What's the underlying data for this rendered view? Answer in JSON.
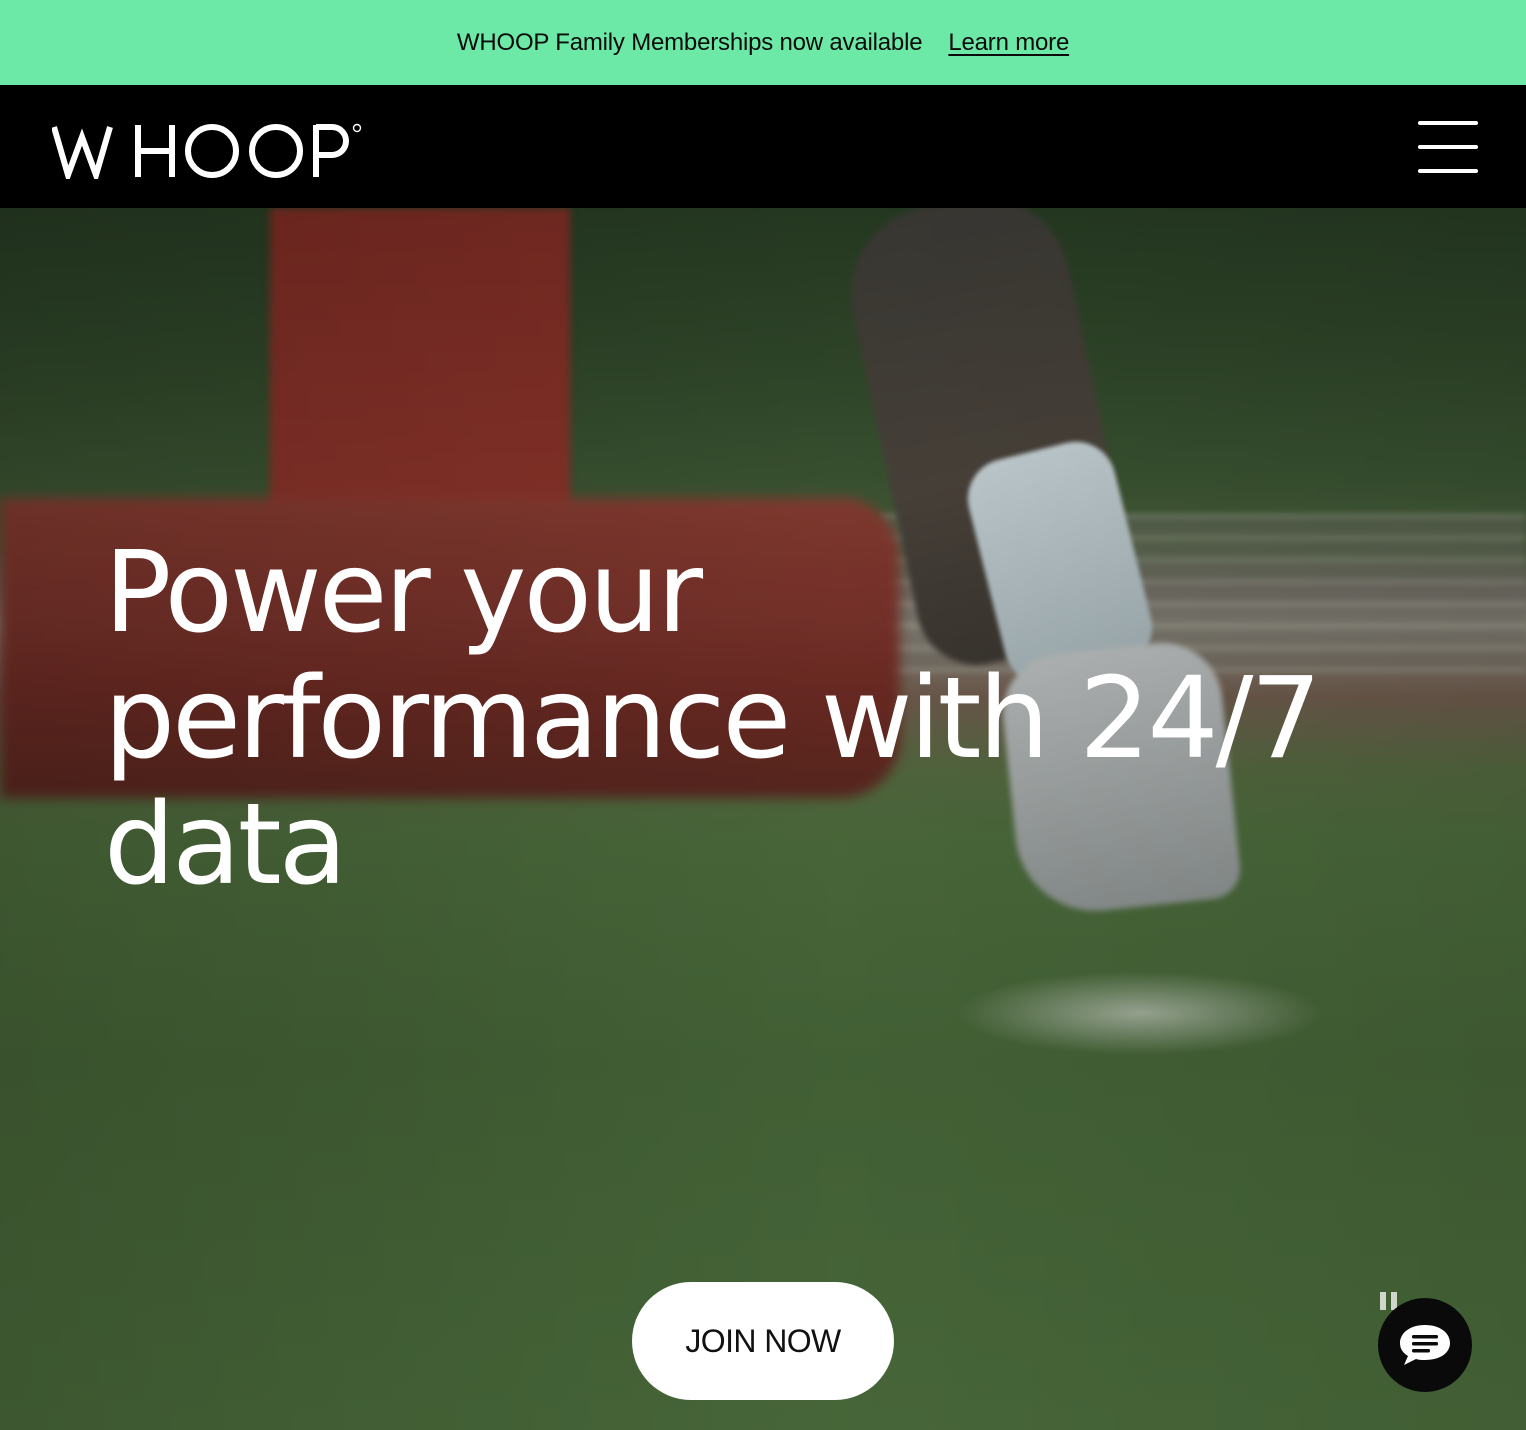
{
  "promo": {
    "text": "WHOOP Family Memberships now available",
    "link_label": "Learn more",
    "background": "#6ce9a6"
  },
  "nav": {
    "logo_text": "WHOOP",
    "logo_icon": "whoop-logo",
    "menu_icon": "hamburger-menu-icon"
  },
  "hero": {
    "headline": "Power your performance with 24/7 data",
    "cta_label": "JOIN NOW",
    "pause_icon": "pause-icon",
    "chat_icon": "chat-bubble-icon"
  }
}
